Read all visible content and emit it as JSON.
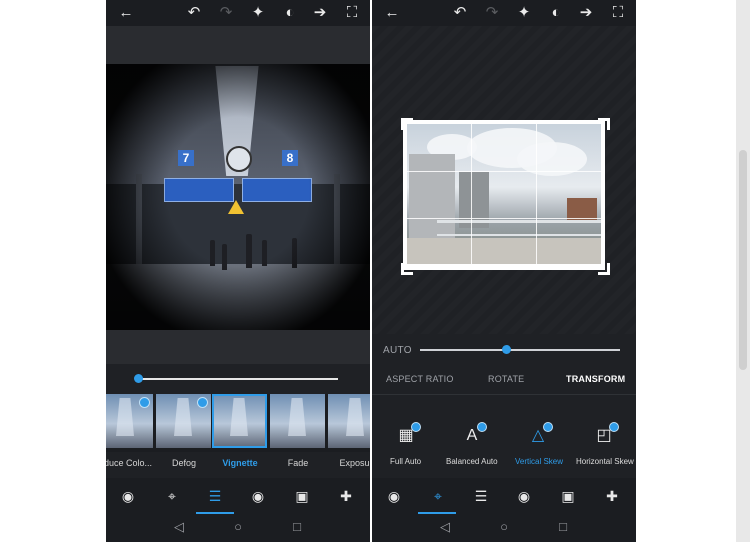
{
  "left": {
    "topbar": {
      "back_icon": "arrow-left-icon",
      "undo_icon": "undo-icon",
      "redo_icon": "redo-icon",
      "auto_fix_icon": "magic-wand-icon",
      "compare_icon": "compare-icon",
      "share_icon": "share-icon",
      "fullscreen_icon": "fullscreen-icon"
    },
    "photo": {
      "sign_left_number": "7",
      "sign_right_number": "8"
    },
    "slider": {
      "value_fraction": 0.0
    },
    "filmstrip": {
      "items": [
        {
          "label": "duce Colo..."
        },
        {
          "label": "Defog"
        },
        {
          "label": "Vignette",
          "active": true
        },
        {
          "label": "Fade"
        },
        {
          "label": "Exposur"
        }
      ]
    },
    "bottom_tools": [
      {
        "name": "looks",
        "icon": "circles-icon"
      },
      {
        "name": "crop",
        "icon": "crop-icon"
      },
      {
        "name": "adjustments",
        "icon": "sliders-icon",
        "active": true
      },
      {
        "name": "red-eye",
        "icon": "eye-icon"
      },
      {
        "name": "frames",
        "icon": "frame-icon"
      },
      {
        "name": "healing",
        "icon": "bandage-icon"
      }
    ]
  },
  "right": {
    "auto_label": "AUTO",
    "slider": {
      "value_fraction": 0.43
    },
    "segments": [
      "ASPECT RATIO",
      "ROTATE",
      "TRANSFORM"
    ],
    "active_segment": "TRANSFORM",
    "tools": [
      {
        "label": "Full Auto",
        "icon": "grid-icon"
      },
      {
        "label": "Balanced Auto",
        "icon": "letter-a-icon"
      },
      {
        "label": "Vertical Skew",
        "icon": "vertical-skew-icon",
        "active": true
      },
      {
        "label": "Horizontal Skew",
        "icon": "horizontal-skew-icon"
      }
    ],
    "bottom_tools": [
      {
        "name": "looks",
        "icon": "circles-icon"
      },
      {
        "name": "crop",
        "icon": "crop-icon",
        "active": true
      },
      {
        "name": "adjustments",
        "icon": "sliders-icon"
      },
      {
        "name": "red-eye",
        "icon": "eye-icon"
      },
      {
        "name": "frames",
        "icon": "frame-icon"
      },
      {
        "name": "healing",
        "icon": "bandage-icon"
      }
    ]
  },
  "navbar": {
    "back": "nav-back-icon",
    "home": "nav-home-icon",
    "recents": "nav-recents-icon"
  },
  "colors": {
    "accent": "#2f9ce8",
    "panel": "#1b1d21"
  }
}
